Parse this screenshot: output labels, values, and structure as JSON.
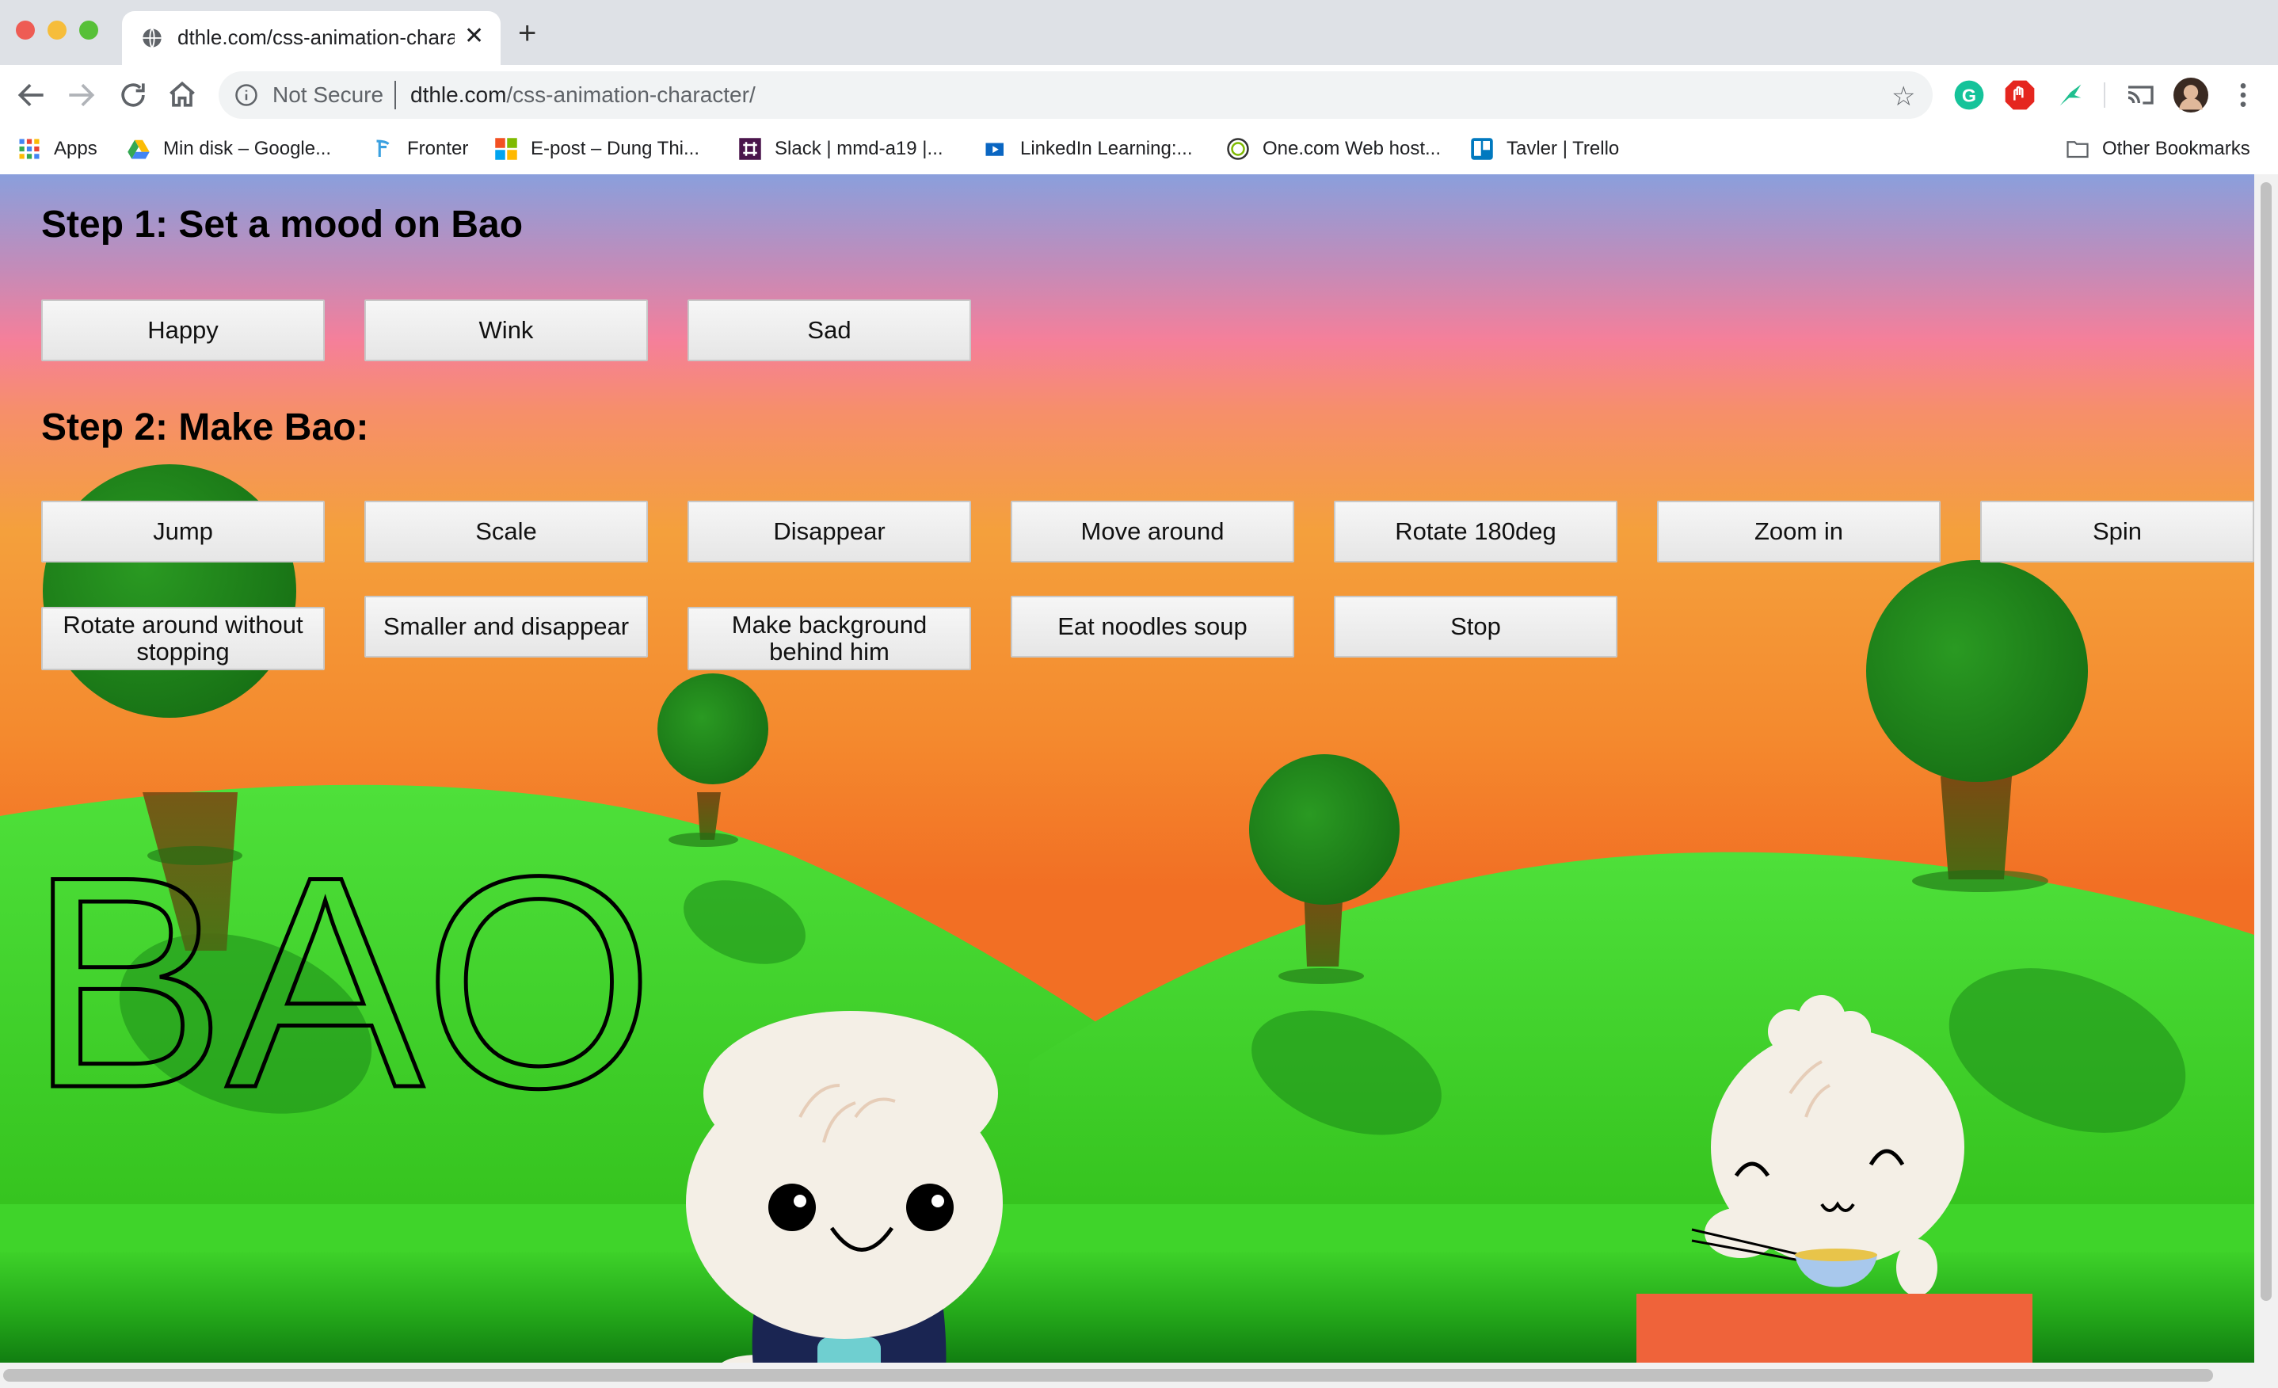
{
  "browser": {
    "tab_title": "dthle.com/css-animation-charac",
    "address": {
      "security_label": "Not Secure",
      "host": "dthle.com",
      "path": "/css-animation-character/"
    },
    "bookmarks": [
      {
        "label": "Apps",
        "icon": "apps-grid-icon"
      },
      {
        "label": "Min disk – Google...",
        "icon": "google-drive-icon"
      },
      {
        "label": "Fronter",
        "icon": "fronter-icon"
      },
      {
        "label": "E-post – Dung Thi...",
        "icon": "microsoft-icon"
      },
      {
        "label": "Slack | mmd-a19 |...",
        "icon": "slack-icon"
      },
      {
        "label": "LinkedIn Learning:...",
        "icon": "linkedin-learning-icon"
      },
      {
        "label": "One.com Web host...",
        "icon": "onecom-icon"
      },
      {
        "label": "Tavler | Trello",
        "icon": "trello-icon"
      }
    ],
    "other_bookmarks": "Other Bookmarks"
  },
  "page": {
    "step1_heading": "Step 1: Set a mood on Bao",
    "mood_buttons": [
      "Happy",
      "Wink",
      "Sad"
    ],
    "step2_heading": "Step 2: Make Bao:",
    "action_buttons_row1": [
      "Jump",
      "Scale",
      "Disappear",
      "Move around",
      "Rotate 180deg",
      "Zoom in",
      "Spin"
    ],
    "action_buttons_row2": [
      "Rotate around without stopping",
      "Smaller and disappear",
      "Make background behind him",
      "Eat noodles soup",
      "Stop"
    ],
    "title_text": "BAO"
  },
  "colors": {
    "hill_green": "#3fd42a",
    "tree_green": "#1e8a1a",
    "bao_body": "#f4efe6",
    "overalls": "#1a2552",
    "pocket": "#6fcfd0",
    "table": "#ef633a"
  }
}
